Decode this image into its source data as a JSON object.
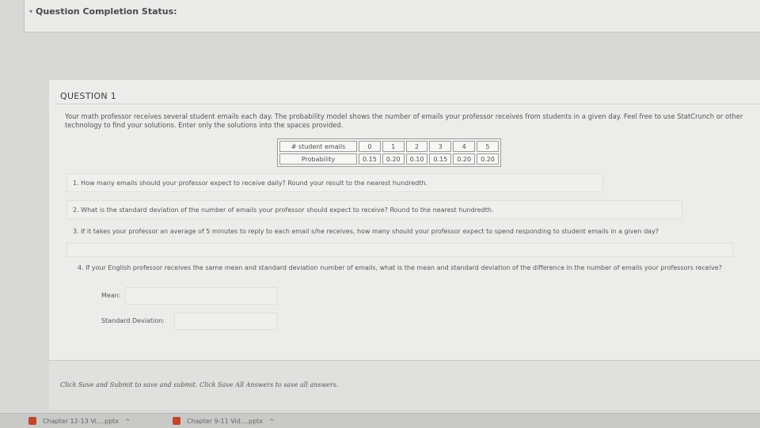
{
  "header": {
    "status_label": "Question Completion Status:"
  },
  "question": {
    "title": "QUESTION 1",
    "intro": "Your math professor receives several student emails each day.  The probability model shows the number of emails your professor receives from students in a given day. Feel free to use StatCrunch or other technology to find your solutions.  Enter only the solutions into the spaces provided.",
    "table": {
      "header_label": "# student emails",
      "values": [
        "0",
        "1",
        "2",
        "3",
        "4",
        "5"
      ],
      "prob_label": "Probability",
      "probabilities": [
        "0.15",
        "0.20",
        "0.10",
        "0.15",
        "0.20",
        "0.20"
      ]
    },
    "items": [
      "1. How many emails should your professor expect to receive daily?  Round your result to the nearest hundredth.",
      "2. What is the standard deviation of the number of emails your professor should expect to receive?  Round to the nearest hundredth.",
      "3. If it takes your professor an average of 5 minutes to reply to each email s/he receives, how many should your professor expect to spend responding to student emails in a given day?",
      "4. If your English professor receives the same mean and standard deviation number of emails, what is the mean and standard deviation of the difference in the number of emails your professors receive?"
    ],
    "mean_label": "Mean:",
    "std_label": "Standard Deviation:"
  },
  "footer": {
    "instruction": "Click Save and Submit to save and submit. Click Save All Answers to save all answers."
  },
  "taskbar": {
    "items": [
      {
        "label": "Chapter 12-13 Vi....pptx",
        "icon": "powerpoint-icon"
      },
      {
        "label": "Chapter 9-11 Vid....pptx",
        "icon": "powerpoint-icon"
      }
    ]
  }
}
